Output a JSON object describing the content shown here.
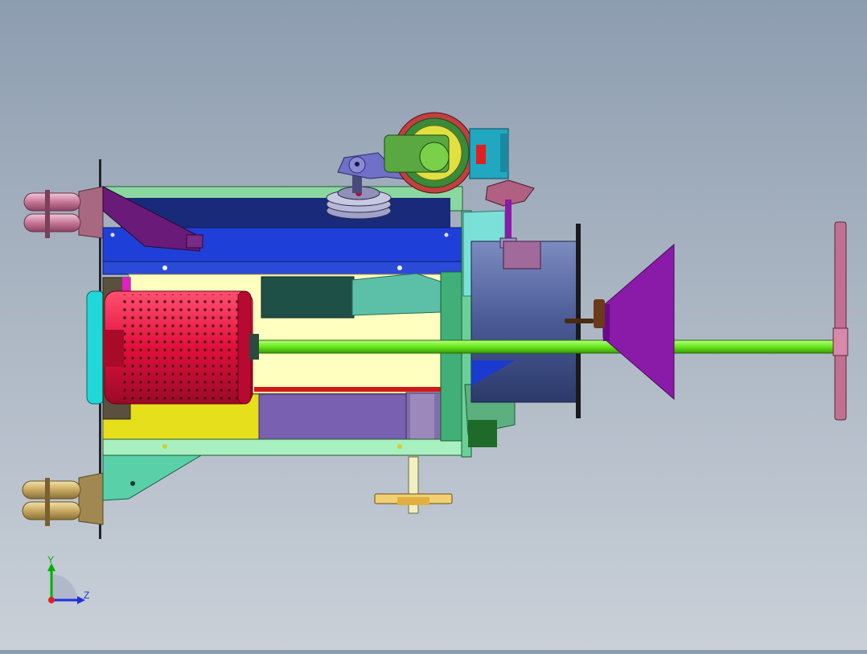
{
  "viewport": {
    "background_top": "#8d9db0",
    "background_bottom": "#c9d0d8"
  },
  "triad": {
    "y_label": "Y",
    "z_label": "Z",
    "y_color": "#00b000",
    "z_color": "#2030e0",
    "x_color": "#e02020"
  },
  "colors": {
    "frame_green": "#8ad8a0",
    "bar_blue": "#1f40d8",
    "body_yellow": "#ffffc0",
    "drum_red": "#e0103c",
    "shaft_green": "#66e81a",
    "funnel_purple": "#8a1aa8",
    "cylinder_slate": "#4a5a90",
    "nozzle_pink": "#c07090",
    "nozzle_gold": "#c8a860",
    "gear_gold": "#f0d070"
  }
}
